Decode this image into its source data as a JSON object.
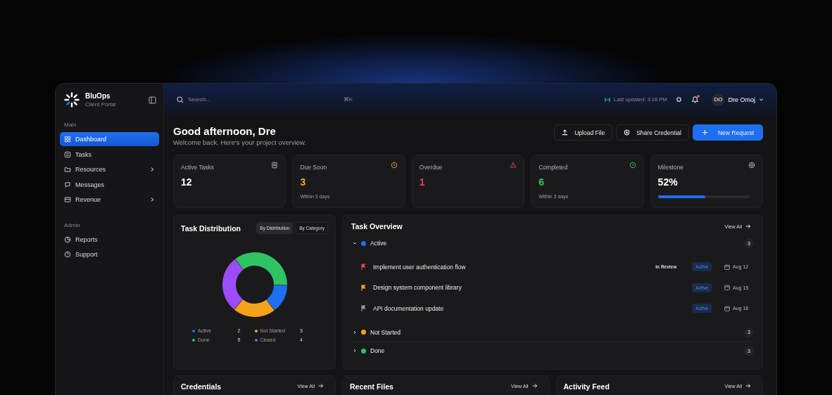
{
  "brand": {
    "name": "BluOps",
    "subtitle": "Client Portal"
  },
  "sidebar": {
    "sections": [
      {
        "title": "Main",
        "items": [
          {
            "label": "Dashboard",
            "selected": true,
            "expandable": false
          },
          {
            "label": "Tasks",
            "selected": false,
            "expandable": false
          },
          {
            "label": "Resources",
            "selected": false,
            "expandable": true
          },
          {
            "label": "Messages",
            "selected": false,
            "expandable": false
          },
          {
            "label": "Revenue",
            "selected": false,
            "expandable": true
          }
        ]
      },
      {
        "title": "Admin",
        "items": [
          {
            "label": "Reports",
            "selected": false,
            "expandable": false
          },
          {
            "label": "Support",
            "selected": false,
            "expandable": false
          }
        ]
      }
    ]
  },
  "topbar": {
    "search": {
      "placeholder": "Search...",
      "shortcut": "⌘K"
    },
    "last_updated": "Last updated: 3:16 PM",
    "notifications_unread": true,
    "user": {
      "initials": "DO",
      "name": "Dre Omoj"
    }
  },
  "header": {
    "title": "Good afternoon, Dre",
    "subtitle": "Welcome back. Here's your project overview.",
    "actions": [
      {
        "label": "Upload File",
        "kind": "upload"
      },
      {
        "label": "Share Credential",
        "kind": "shield"
      },
      {
        "label": "New Request",
        "kind": "primary"
      }
    ]
  },
  "stats": [
    {
      "label": "Active Tasks",
      "value": "12",
      "kind": "tasks",
      "color": "#ffffff"
    },
    {
      "label": "Due Soon",
      "value": "3",
      "note": "Within 3 days",
      "kind": "clock",
      "color": "#f5a524"
    },
    {
      "label": "Overdue",
      "value": "1",
      "kind": "alert",
      "color": "#e5484d"
    },
    {
      "label": "Completed",
      "value": "6",
      "note": "Within 3 days",
      "kind": "check",
      "color": "#30c85e"
    },
    {
      "label": "Milestone",
      "value": "52%",
      "kind": "milestone",
      "color": "#ffffff",
      "level": 0.52
    }
  ],
  "task_distribution": {
    "title": "Task Distribution",
    "tabs": [
      {
        "label": "By Distribution",
        "selected": true
      },
      {
        "label": "By Category",
        "selected": false
      }
    ],
    "chart_data": {
      "type": "donut",
      "categories": [
        "Done",
        "Active",
        "Not Started",
        "Closed"
      ],
      "series": [
        {
          "values": [
            35.7,
            14.3,
            21.4,
            28.6
          ]
        }
      ],
      "value_labels": [
        "5",
        "2",
        "3",
        "4"
      ],
      "colors": [
        "#2ec463",
        "#1f6ff2",
        "#f5a21b",
        "#9b4dfa"
      ]
    }
  },
  "task_overview": {
    "title": "Task Overview",
    "view_all": "View All",
    "groups": [
      {
        "label": "Active",
        "color": "#1f6ff2",
        "count": "3",
        "expanded": true,
        "tasks": [
          {
            "title": "Implement user authentication flow",
            "color": "#e5484d",
            "status": "In Review",
            "badge": "Active",
            "date": "Aug 12"
          },
          {
            "title": "Design system component library",
            "color": "#f5a524",
            "badge": "Active",
            "date": "Aug 15"
          },
          {
            "title": "API documentation update",
            "color": "#9a9aa0",
            "badge": "Active",
            "date": "Aug 18"
          }
        ]
      },
      {
        "label": "Not Started",
        "color": "#f5a21b",
        "count": "3",
        "expanded": false
      },
      {
        "label": "Done",
        "color": "#2ec463",
        "count": "3",
        "expanded": false
      }
    ]
  },
  "bottom_cards": [
    {
      "title": "Credentials",
      "view_all": "View All"
    },
    {
      "title": "Recent Files",
      "view_all": "View All"
    },
    {
      "title": "Activity Feed",
      "view_all": "View All"
    }
  ]
}
